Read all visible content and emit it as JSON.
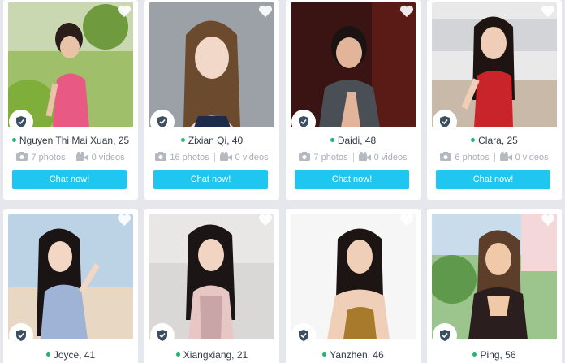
{
  "icons": {
    "heart": "heart-icon",
    "shield": "verified-shield-icon",
    "camera": "camera-icon",
    "video": "video-camera-icon"
  },
  "colors": {
    "online": "#21b573",
    "chat_button": "#1fc6f0",
    "background": "#e6e7ec"
  },
  "profiles": [
    {
      "name": "Nguyen Thi Mai Xuan, 25",
      "photos": "7 photos",
      "videos": "0 videos",
      "chat": "Chat now!"
    },
    {
      "name": "Zixian Qi, 40",
      "photos": "16 photos",
      "videos": "0 videos",
      "chat": "Chat now!"
    },
    {
      "name": "Daidi, 48",
      "photos": "7 photos",
      "videos": "0 videos",
      "chat": "Chat now!"
    },
    {
      "name": "Clara, 25",
      "photos": "6 photos",
      "videos": "0 videos",
      "chat": "Chat now!"
    },
    {
      "name": "Joyce, 41"
    },
    {
      "name": "Xiangxiang, 21"
    },
    {
      "name": "Yanzhen, 46"
    },
    {
      "name": "Ping, 56"
    }
  ]
}
